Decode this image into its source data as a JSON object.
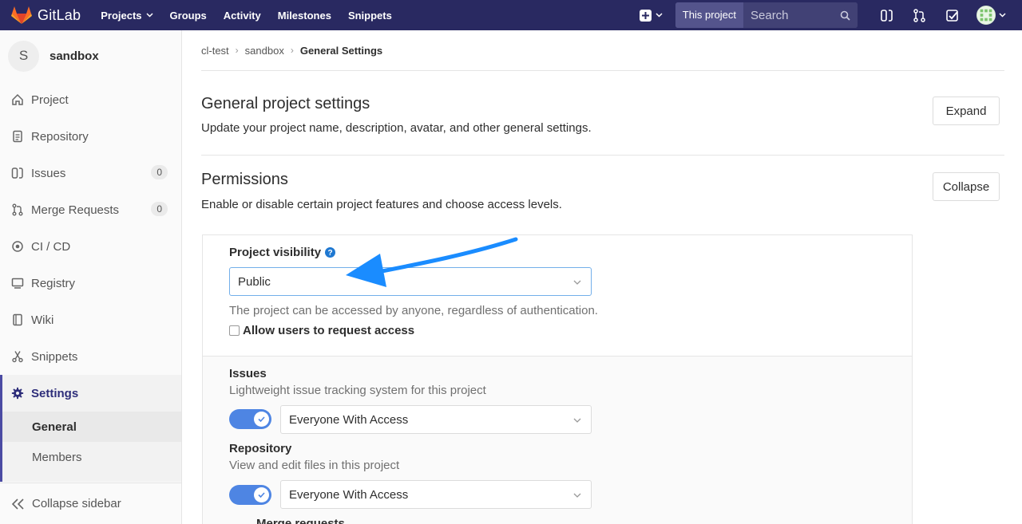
{
  "navbar": {
    "brand": "GitLab",
    "links": [
      "Projects",
      "Groups",
      "Activity",
      "Milestones",
      "Snippets"
    ],
    "search_scope": "This project",
    "search_placeholder": "Search"
  },
  "sidebar": {
    "project_initial": "S",
    "project_name": "sandbox",
    "items": [
      {
        "label": "Project",
        "icon": "home-icon"
      },
      {
        "label": "Repository",
        "icon": "document-icon"
      },
      {
        "label": "Issues",
        "icon": "issues-icon",
        "count": "0"
      },
      {
        "label": "Merge Requests",
        "icon": "merge-request-icon",
        "count": "0"
      },
      {
        "label": "CI / CD",
        "icon": "rocket-icon"
      },
      {
        "label": "Registry",
        "icon": "monitor-icon"
      },
      {
        "label": "Wiki",
        "icon": "book-icon"
      },
      {
        "label": "Snippets",
        "icon": "scissors-icon"
      },
      {
        "label": "Settings",
        "icon": "gear-icon"
      }
    ],
    "sub_items": [
      {
        "label": "General"
      },
      {
        "label": "Members"
      }
    ],
    "collapse_label": "Collapse sidebar"
  },
  "breadcrumb": {
    "items": [
      "cl-test",
      "sandbox"
    ],
    "current": "General Settings"
  },
  "general": {
    "title": "General project settings",
    "description": "Update your project name, description, avatar, and other general settings.",
    "button": "Expand"
  },
  "permissions": {
    "title": "Permissions",
    "description": "Enable or disable certain project features and choose access levels.",
    "button": "Collapse",
    "visibility_label": "Project visibility",
    "visibility_value": "Public",
    "visibility_hint": "The project can be accessed by anyone, regardless of authentication.",
    "request_access_label": "Allow users to request access",
    "features": [
      {
        "label": "Issues",
        "hint": "Lightweight issue tracking system for this project",
        "value": "Everyone With Access"
      },
      {
        "label": "Repository",
        "hint": "View and edit files in this project",
        "value": "Everyone With Access"
      }
    ],
    "next_label": "Merge requests"
  },
  "colors": {
    "navbar": "#292961",
    "accent": "#4b4ba3",
    "toggle": "#4e85e3",
    "annotation_arrow": "#1a8cff"
  }
}
